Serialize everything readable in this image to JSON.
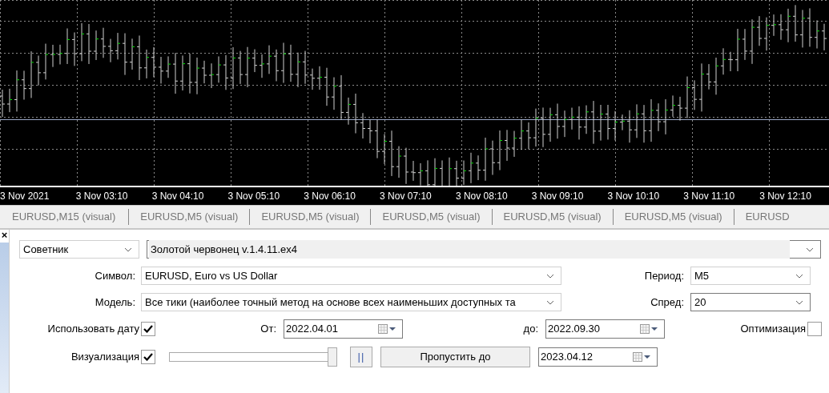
{
  "chart": {
    "time_labels": [
      "3 Nov 2021",
      "3 Nov 03:10",
      "3 Nov 04:10",
      "3 Nov 05:10",
      "3 Nov 06:10",
      "3 Nov 07:10",
      "3 Nov 08:10",
      "3 Nov 09:10",
      "3 Nov 10:10",
      "3 Nov 11:10",
      "3 Nov 12:10"
    ]
  },
  "tabs": [
    "EURUSD,M15 (visual)",
    "EURUSD,M5 (visual)",
    "EURUSD,M5 (visual)",
    "EURUSD,M5 (visual)",
    "EURUSD,M5 (visual)",
    "EURUSD,M5 (visual)",
    "EURUSD"
  ],
  "panel": {
    "close": "×",
    "expert_type": {
      "value": "Советник"
    },
    "expert": {
      "value": "Золотой червонец v.1.4.11.ex4"
    },
    "symbol": {
      "label": "Символ:",
      "value": "EURUSD, Euro vs US Dollar"
    },
    "period": {
      "label": "Период:",
      "value": "M5"
    },
    "model": {
      "label": "Модель:",
      "value": "Все тики (наиболее точный метод на основе всех наименьших доступных та"
    },
    "spread": {
      "label": "Спред:",
      "value": "20"
    },
    "use_date": {
      "label": "Использовать дату",
      "checked": true
    },
    "from": {
      "label": "От:",
      "value": "2022.04.01"
    },
    "to": {
      "label": "до:",
      "value": "2022.09.30"
    },
    "optimization": {
      "label": "Оптимизация",
      "checked": false
    },
    "visualization": {
      "label": "Визуализация",
      "checked": true
    },
    "speed": {
      "level": 1
    },
    "pause": {
      "label": "||"
    },
    "skip_button": {
      "label": "Пропустить до"
    },
    "skip_date": {
      "value": "2023.04.12"
    }
  }
}
